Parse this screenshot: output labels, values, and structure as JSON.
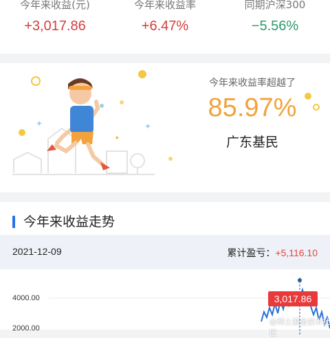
{
  "stats": [
    {
      "label": "今年来收益(元)",
      "value": "+3,017.86",
      "color": "#d63c3c"
    },
    {
      "label": "今年来收益率",
      "value": "+6.47%",
      "color": "#d63c3c"
    },
    {
      "label": "同期沪深300",
      "value": "−5.56%",
      "color": "#2c9a6a"
    }
  ],
  "rank_card": {
    "caption": "今年来收益率超越了",
    "percent": "85.97%",
    "subject": "广东基民"
  },
  "trend": {
    "title": "今年来收益走势",
    "date": "2021-12-09",
    "cumulative_label": "累计盈亏：",
    "cumulative_value": "+5,116.10",
    "y_ticks": [
      "4000.00",
      "2000.00"
    ],
    "tooltip": "3,017.86"
  },
  "watermark": "@稀土掘金技术社区"
}
